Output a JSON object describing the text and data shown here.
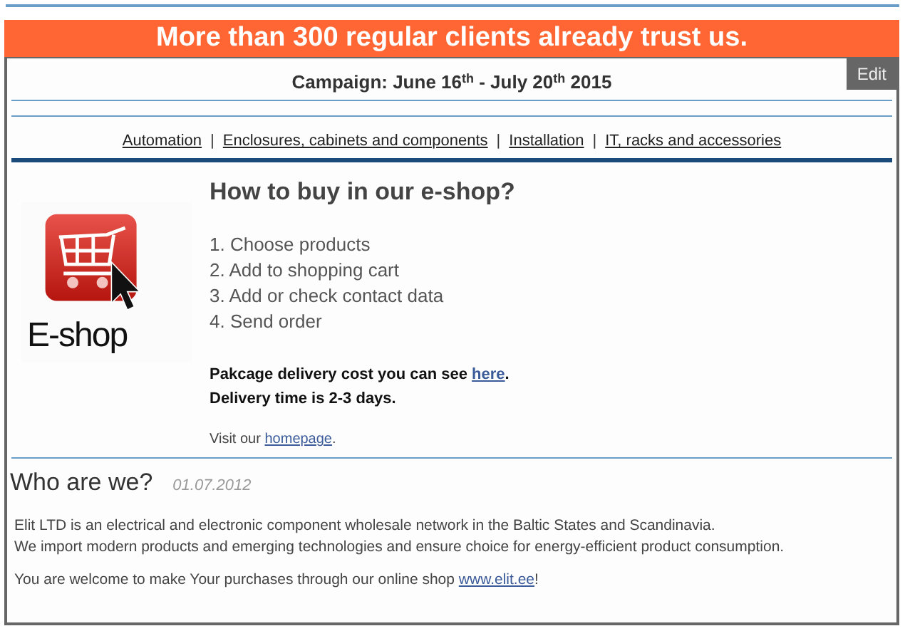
{
  "banner": "More than 300 regular clients already trust us.",
  "edit_button": "Edit",
  "campaign": "Campaign: June 16$^{th}$ - July 20$^{th}$ 2015",
  "nav_links": [
    "Automation",
    "Enclosures, cabinets and components",
    "Installation",
    "IT, racks and accessories"
  ],
  "nav_separator": "|",
  "howto": {
    "logo_text": "E-shop",
    "title": "How to buy in our e-shop?",
    "steps": [
      "1. Choose products",
      "2. Add to shopping cart",
      "3. Add or check contact data",
      "4. Send order"
    ],
    "delivery_cost": {
      "before": "Pakcage delivery cost you can see ",
      "link": "here",
      "after": "."
    },
    "delivery_time": "Delivery time is 2-3 days.",
    "visit": {
      "before": "Visit our ",
      "link": "homepage",
      "after": "."
    }
  },
  "about": {
    "title": "Who are we?",
    "date": "01.07.2012",
    "paragraph_lines": [
      "Elit LTD is an electrical and electronic component wholesale network in the Baltic States and Scandinavia.",
      "We import modern products and emerging technologies and ensure choice for energy-efficient product consumption."
    ],
    "welcome": {
      "before": "You are welcome to make Your purchases through our online shop ",
      "link": "www.elit.ee",
      "after": "!"
    }
  }
}
